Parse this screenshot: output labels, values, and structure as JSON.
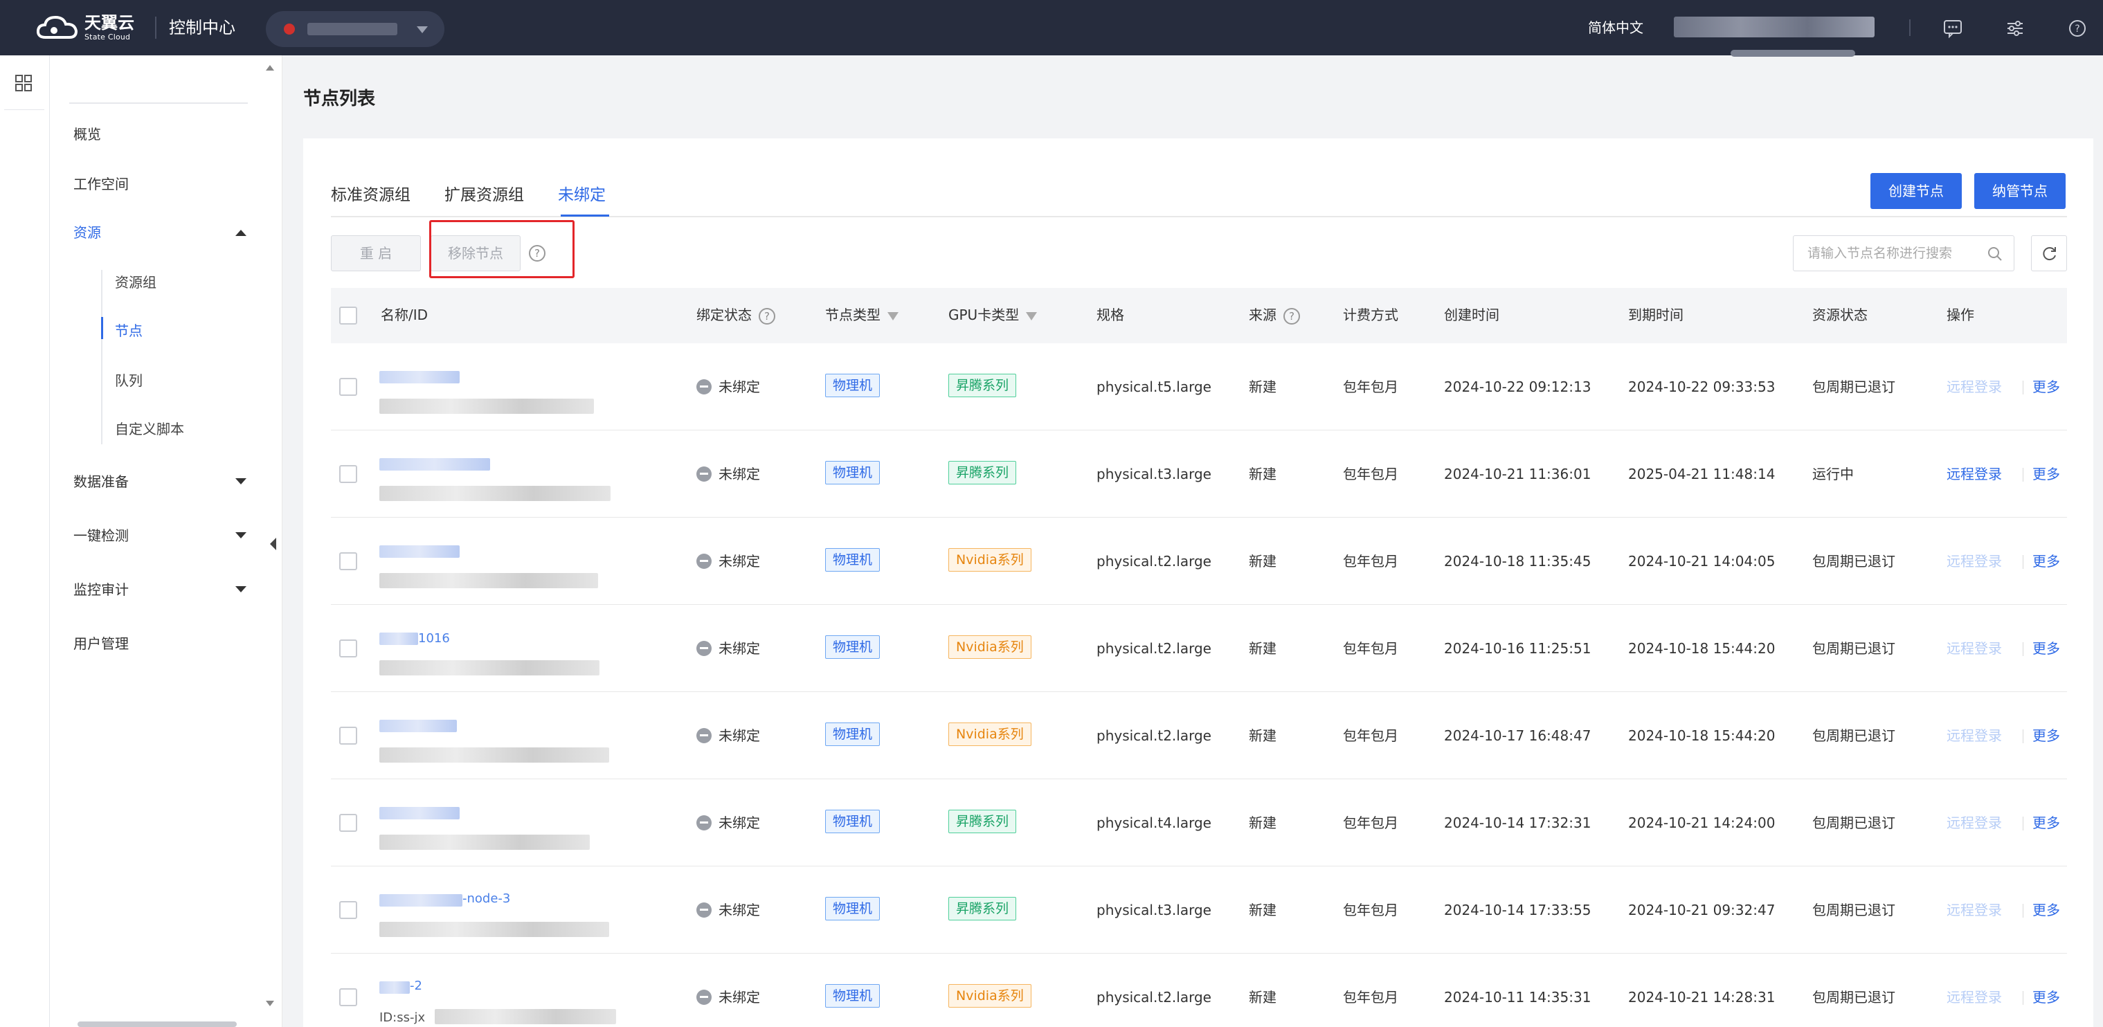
{
  "topbar": {
    "logo_cn": "天翼云",
    "logo_en": "State Cloud",
    "console_title": "控制中心",
    "language": "简体中文"
  },
  "sidebar": {
    "items": [
      {
        "label": "概览"
      },
      {
        "label": "工作空间"
      },
      {
        "label": "资源",
        "expanded": true,
        "active": true
      },
      {
        "label": "数据准备"
      },
      {
        "label": "一键检测"
      },
      {
        "label": "监控审计"
      },
      {
        "label": "用户管理"
      }
    ],
    "resource_children": [
      {
        "label": "资源组"
      },
      {
        "label": "节点",
        "active": true
      },
      {
        "label": "队列"
      },
      {
        "label": "自定义脚本"
      }
    ]
  },
  "page": {
    "title": "节点列表",
    "tabs": [
      "标准资源组",
      "扩展资源组",
      "未绑定"
    ],
    "active_tab": "未绑定",
    "create_button": "创建节点",
    "manage_button": "纳管节点",
    "restart_button": "重 启",
    "remove_button": "移除节点",
    "help_glyph": "?",
    "search_placeholder": "请输入节点名称进行搜索"
  },
  "table": {
    "columns": [
      "名称/ID",
      "绑定状态",
      "节点类型",
      "GPU卡类型",
      "规格",
      "来源",
      "计费方式",
      "创建时间",
      "到期时间",
      "资源状态",
      "操作"
    ],
    "rows": [
      {
        "bind_status": "未绑定",
        "node_type": "物理机",
        "gpu_type": "昇腾系列",
        "spec": "physical.t5.large",
        "source": "新建",
        "billing": "包年包月",
        "created": "2024-10-22 09:12:13",
        "expires": "2024-10-22 09:33:53",
        "status": "包周期已退订",
        "remote": "远程登录",
        "more": "更多"
      },
      {
        "bind_status": "未绑定",
        "node_type": "物理机",
        "gpu_type": "昇腾系列",
        "spec": "physical.t3.large",
        "source": "新建",
        "billing": "包年包月",
        "created": "2024-10-21 11:36:01",
        "expires": "2025-04-21 11:48:14",
        "status": "运行中",
        "remote": "远程登录",
        "more": "更多"
      },
      {
        "bind_status": "未绑定",
        "node_type": "物理机",
        "gpu_type": "Nvidia系列",
        "spec": "physical.t2.large",
        "source": "新建",
        "billing": "包年包月",
        "created": "2024-10-18 11:35:45",
        "expires": "2024-10-21 14:04:05",
        "status": "包周期已退订",
        "remote": "远程登录",
        "more": "更多"
      },
      {
        "name_fragment": "1016",
        "bind_status": "未绑定",
        "node_type": "物理机",
        "gpu_type": "Nvidia系列",
        "spec": "physical.t2.large",
        "source": "新建",
        "billing": "包年包月",
        "created": "2024-10-16 11:25:51",
        "expires": "2024-10-18 15:44:20",
        "status": "包周期已退订",
        "remote": "远程登录",
        "more": "更多"
      },
      {
        "bind_status": "未绑定",
        "node_type": "物理机",
        "gpu_type": "Nvidia系列",
        "spec": "physical.t2.large",
        "source": "新建",
        "billing": "包年包月",
        "created": "2024-10-17 16:48:47",
        "expires": "2024-10-18 15:44:20",
        "status": "包周期已退订",
        "remote": "远程登录",
        "more": "更多"
      },
      {
        "bind_status": "未绑定",
        "node_type": "物理机",
        "gpu_type": "昇腾系列",
        "spec": "physical.t4.large",
        "source": "新建",
        "billing": "包年包月",
        "created": "2024-10-14 17:32:31",
        "expires": "2024-10-21 14:24:00",
        "status": "包周期已退订",
        "remote": "远程登录",
        "more": "更多"
      },
      {
        "name_fragment": "-node-3",
        "bind_status": "未绑定",
        "node_type": "物理机",
        "gpu_type": "昇腾系列",
        "spec": "physical.t3.large",
        "source": "新建",
        "billing": "包年包月",
        "created": "2024-10-14 17:33:55",
        "expires": "2024-10-21 09:32:47",
        "status": "包周期已退订",
        "remote": "远程登录",
        "more": "更多"
      },
      {
        "name_fragment": "-2",
        "id_fragment": "ID:ss-jx",
        "bind_status": "未绑定",
        "node_type": "物理机",
        "gpu_type": "Nvidia系列",
        "spec": "physical.t2.large",
        "source": "新建",
        "billing": "包年包月",
        "created": "2024-10-11 14:35:31",
        "expires": "2024-10-21 14:28:31",
        "status": "包周期已退订",
        "remote": "远程登录",
        "more": "更多"
      }
    ]
  },
  "colors": {
    "topbar_bg": "#262c3d",
    "primary": "#2f6ae6",
    "highlight_box": "#e3262a",
    "ascend_tag": "#19a366",
    "nvidia_tag": "#e6850f"
  },
  "icons": [
    "cloud-logo-icon",
    "apps-grid-icon",
    "message-icon",
    "settings-sliders-icon",
    "help-circle-icon",
    "search-icon",
    "refresh-icon",
    "filter-icon"
  ]
}
